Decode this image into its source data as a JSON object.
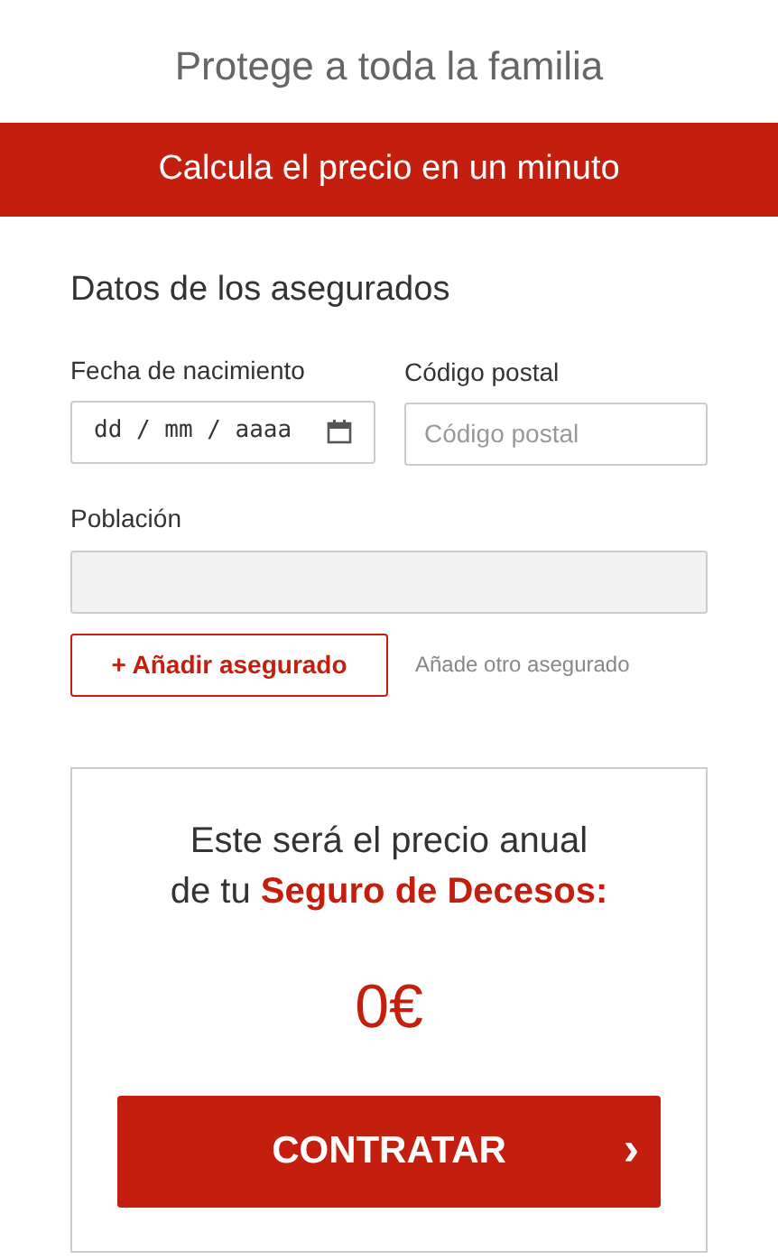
{
  "header": {
    "title": "Protege a toda la familia"
  },
  "banner": {
    "text": "Calcula el precio en un minuto"
  },
  "form": {
    "heading": "Datos de los asegurados",
    "birth_date": {
      "label": "Fecha de nacimiento",
      "placeholder": "dd / mm / aaaa"
    },
    "postal_code": {
      "label": "Código postal",
      "placeholder": "Código postal"
    },
    "town": {
      "label": "Población",
      "disabled": true
    },
    "add_button": "+ Añadir asegurado",
    "add_hint": "Añade otro asegurado"
  },
  "price_card": {
    "text": "Este será el precio anual\nde tu **Seguro de Decesos:**",
    "price": "0€",
    "button": "CONTRATAR",
    "button_arrow": "›"
  }
}
